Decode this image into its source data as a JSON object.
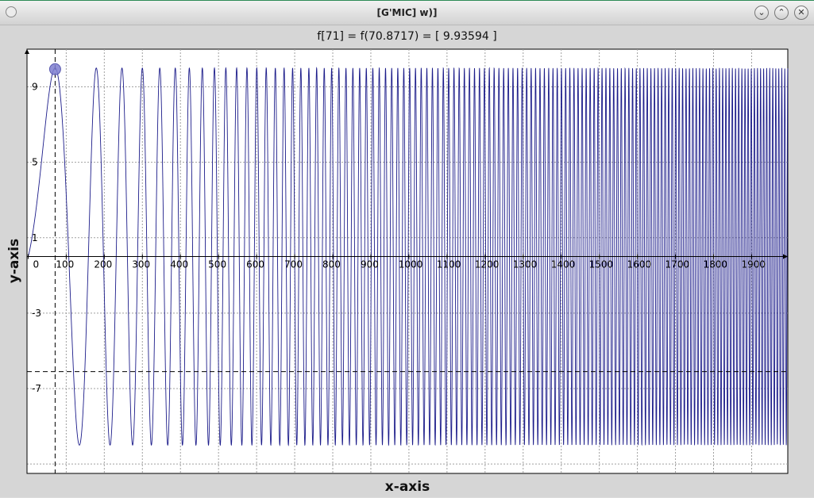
{
  "window": {
    "title": "[G'MIC] w)]",
    "buttons": {
      "minimize": "⌄",
      "maximize": "⌃",
      "close": "✕"
    }
  },
  "chart_data": {
    "type": "line",
    "title": "f[71] = f(70.8717) = [ 9.93594 ]",
    "xlabel": "x-axis",
    "ylabel": "y-axis",
    "xlim": [
      -3,
      1995
    ],
    "ylim": [
      -11.5,
      11.0
    ],
    "x_ticks": [
      0,
      100,
      200,
      300,
      400,
      500,
      600,
      700,
      800,
      900,
      1000,
      1100,
      1200,
      1300,
      1400,
      1500,
      1600,
      1700,
      1800,
      1900
    ],
    "y_ticks": [
      9,
      5,
      1,
      -3,
      -7
    ],
    "grid": true,
    "series": [
      {
        "color": "#1c1c8a",
        "function": "10*sin(0.0002*x*x + 0.0081*x - 0.0015)",
        "x_range": [
          0,
          1995
        ],
        "samples": 8000
      }
    ],
    "cursor": {
      "x": 70.8717,
      "y": 9.93594,
      "color": "#7f7fd0"
    }
  }
}
